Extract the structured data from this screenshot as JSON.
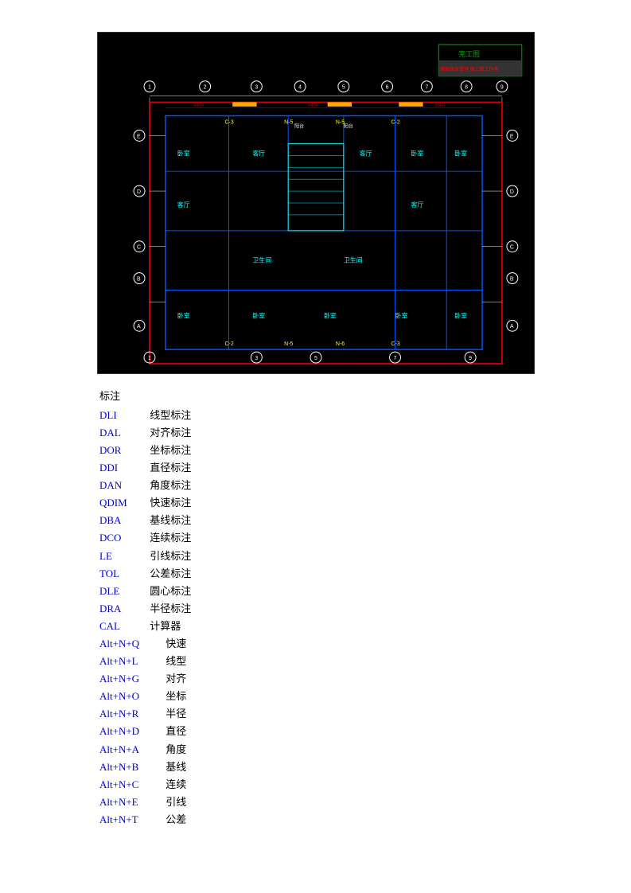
{
  "drawing": {
    "alt": "CAD Floor Plan Drawing"
  },
  "section_header": "标注",
  "commands": [
    {
      "cmd": "DLI",
      "desc": "线型标注"
    },
    {
      "cmd": "DAL",
      "desc": "对齐标注"
    },
    {
      "cmd": "DOR",
      "desc": "坐标标注"
    },
    {
      "cmd": "DDI",
      "desc": "直径标注"
    },
    {
      "cmd": "DAN",
      "desc": "角度标注"
    },
    {
      "cmd": "QDIM",
      "desc": "快速标注"
    },
    {
      "cmd": "DBA",
      "desc": "基线标注"
    },
    {
      "cmd": "DCO",
      "desc": "连续标注"
    },
    {
      "cmd": "LE",
      "desc": "引线标注"
    },
    {
      "cmd": "TOL",
      "desc": "公差标注"
    },
    {
      "cmd": "DLE",
      "desc": "圆心标注"
    },
    {
      "cmd": "DRA",
      "desc": "半径标注"
    },
    {
      "cmd": "CAL",
      "desc": "计算器"
    }
  ],
  "shortcuts": [
    {
      "key": "Alt+N+Q",
      "desc": "快速"
    },
    {
      "key": "Alt+N+L",
      "desc": "线型"
    },
    {
      "key": "Alt+N+G",
      "desc": "对齐"
    },
    {
      "key": "Alt+N+O",
      "desc": "坐标"
    },
    {
      "key": "Alt+N+R",
      "desc": "半径"
    },
    {
      "key": "Alt+N+D",
      "desc": "直径"
    },
    {
      "key": "Alt+N+A",
      "desc": "角度"
    },
    {
      "key": "Alt+N+B",
      "desc": "基线"
    },
    {
      "key": "Alt+N+C",
      "desc": "连续"
    },
    {
      "key": "Alt+N+E",
      "desc": "引线"
    },
    {
      "key": "Alt+N+T",
      "desc": "公差"
    }
  ]
}
